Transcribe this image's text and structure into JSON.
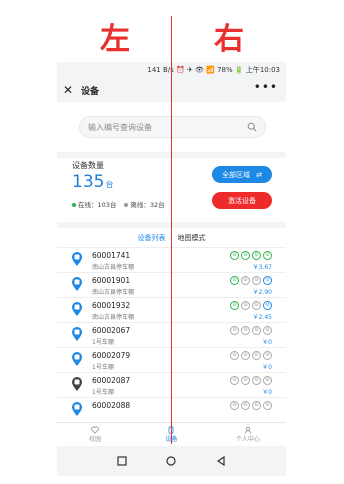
{
  "annotations": {
    "left": "左",
    "right": "右"
  },
  "status_bar": {
    "text": "141 B/s ⏰ ✈ 👁 📶 78% 🔋 上午10:03"
  },
  "nav": {
    "title": "设备",
    "close": "✕",
    "more": "•••"
  },
  "search": {
    "placeholder": "输入编号查询设备"
  },
  "summary": {
    "label": "设备数量",
    "count": "135",
    "unit": "台",
    "online": "在线：103台",
    "offline": "离线：32台",
    "btn_area": "全部区域",
    "btn_area_icon": "⇄",
    "btn_activate": "激活设备"
  },
  "tabs": {
    "list": "设备列表",
    "map": "地图模式"
  },
  "devices": [
    {
      "id": "60001741",
      "loc": "南山古县停车棚",
      "amount": "￥3.67",
      "pin": "#1e88e5",
      "icon_style": "green"
    },
    {
      "id": "60001901",
      "loc": "南山古县停车棚",
      "amount": "￥2.90",
      "pin": "#1e88e5",
      "icon_style": "mixed"
    },
    {
      "id": "60001932",
      "loc": "南山古县停车棚",
      "amount": "￥2.45",
      "pin": "#1e88e5",
      "icon_style": "mixed"
    },
    {
      "id": "60002067",
      "loc": "1号车棚",
      "amount": "￥0",
      "pin": "#1e88e5",
      "icon_style": "gray"
    },
    {
      "id": "60002079",
      "loc": "1号车棚",
      "amount": "￥0",
      "pin": "#1e88e5",
      "icon_style": "gray"
    },
    {
      "id": "60002087",
      "loc": "1号车棚",
      "amount": "￥0",
      "pin": "#444444",
      "icon_style": "gray"
    },
    {
      "id": "60002088",
      "loc": "",
      "amount": "",
      "pin": "#1e88e5",
      "icon_style": "gray"
    }
  ],
  "bottom_nav": {
    "item1": "校园",
    "item2": "设备",
    "item3": "个人中心"
  },
  "icons": {
    "search": "search-icon",
    "close": "close-icon",
    "more": "more-icon"
  }
}
